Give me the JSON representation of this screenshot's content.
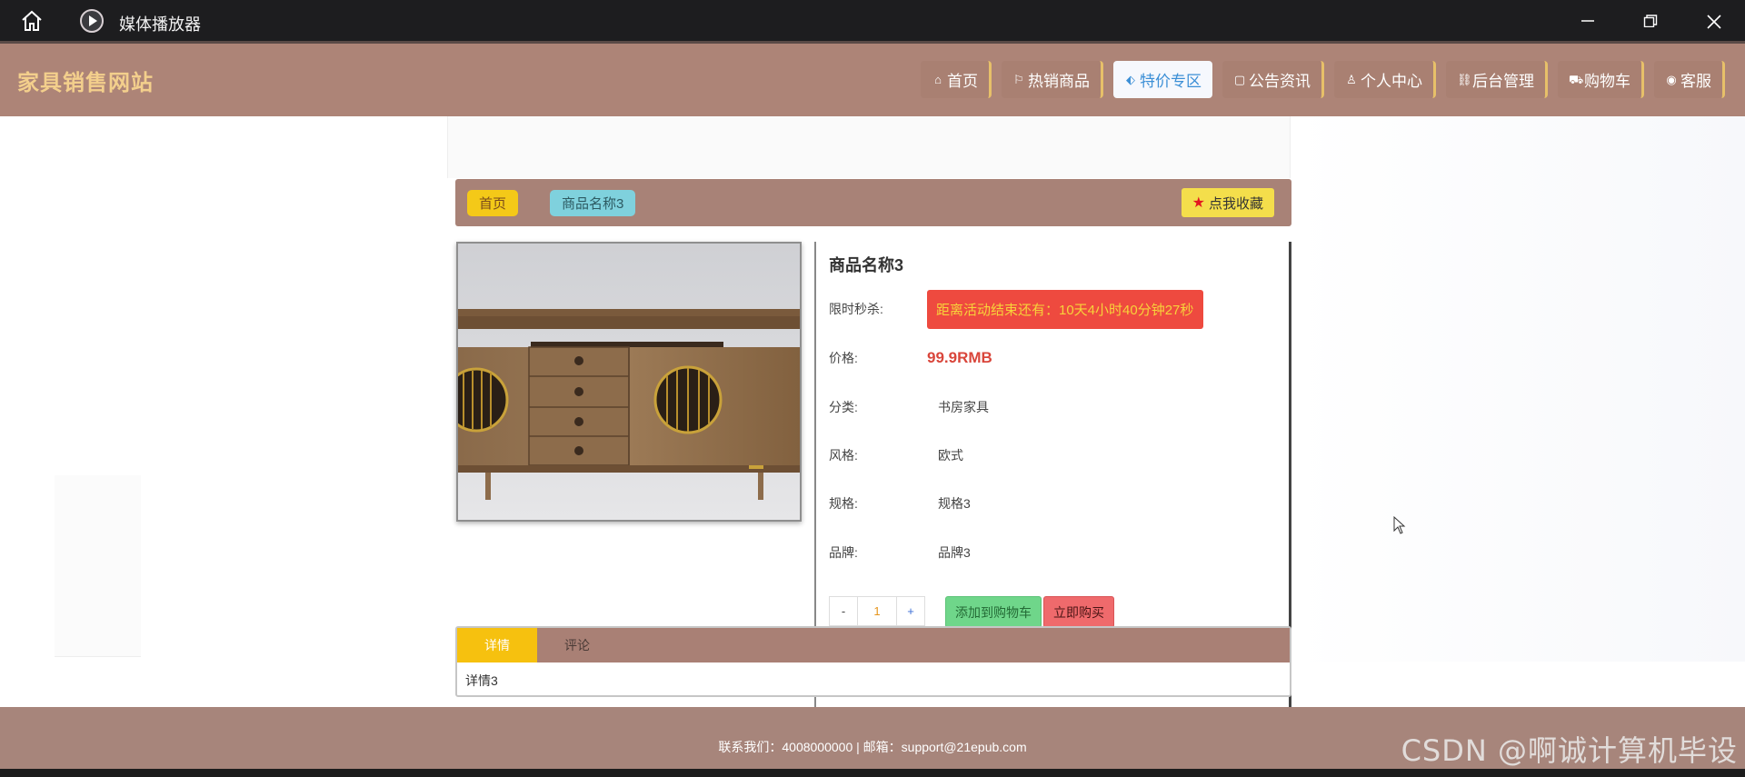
{
  "window": {
    "title": "媒体播放器"
  },
  "header": {
    "logo": "家具销售网站",
    "nav": [
      {
        "icon": "home-icon",
        "glyph": "⌂",
        "label": "首页"
      },
      {
        "icon": "flag-icon",
        "glyph": "⚐",
        "label": "热销商品"
      },
      {
        "icon": "tag-icon",
        "glyph": "⬖",
        "label": "特价专区"
      },
      {
        "icon": "document-icon",
        "glyph": "▢",
        "label": "公告资讯"
      },
      {
        "icon": "user-icon",
        "glyph": "♙",
        "label": "个人中心"
      },
      {
        "icon": "link-icon",
        "glyph": "⛓",
        "label": "后台管理"
      },
      {
        "icon": "cart-icon",
        "glyph": "⛟",
        "label": "购物车"
      },
      {
        "icon": "chat-icon",
        "glyph": "◉",
        "label": "客服"
      }
    ],
    "active_nav": "特价专区"
  },
  "breadcrumb": {
    "home": "首页",
    "product": "商品名称3",
    "favorite_label": "点我收藏"
  },
  "product": {
    "name": "商品名称3",
    "flash_label": "限时秒杀:",
    "countdown": "距离活动结束还有：10天4小时40分钟27秒",
    "price_label": "价格:",
    "price": "99.9RMB",
    "category_label": "分类:",
    "category": "书房家具",
    "style_label": "风格:",
    "style": "欧式",
    "spec_label": "规格:",
    "spec": "规格3",
    "brand_label": "品牌:",
    "brand": "品牌3",
    "quantity": "1",
    "minus": "-",
    "plus": "+",
    "add_to_cart": "添加到购物车",
    "buy_now": "立即购买"
  },
  "tabs": {
    "items": [
      "详情",
      "评论"
    ],
    "active": "详情",
    "content": "详情3"
  },
  "footer": {
    "text": "联系我们：4008000000 | 邮箱：support@21epub.com"
  },
  "watermark": "CSDN @啊诚计算机毕设",
  "colors": {
    "header_bg": "#ad8477",
    "logo": "#f3cf8c",
    "accent_yellow": "#f4c918",
    "price_red": "#d9463b",
    "countdown_bg": "#ee4a3f"
  }
}
